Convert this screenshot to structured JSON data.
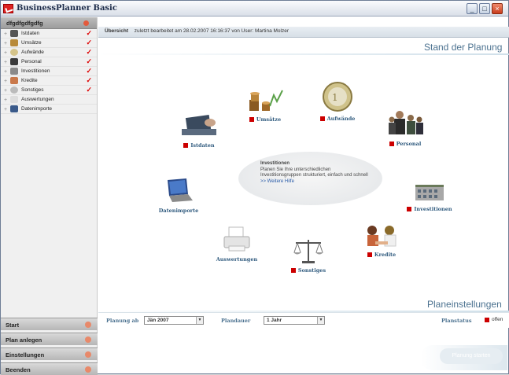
{
  "window": {
    "title": "BusinessPlanner Basic"
  },
  "sidebar": {
    "header": "dfgdfgdfgdfg",
    "items": [
      {
        "label": "Istdaten",
        "icon": "desk-user-icon",
        "checked": true
      },
      {
        "label": "Umsätze",
        "icon": "coins-icon",
        "checked": true
      },
      {
        "label": "Aufwände",
        "icon": "coin-icon",
        "checked": true
      },
      {
        "label": "Personal",
        "icon": "people-icon",
        "checked": true
      },
      {
        "label": "Investitionen",
        "icon": "building-icon",
        "checked": true
      },
      {
        "label": "Kredite",
        "icon": "handshake-icon",
        "checked": true
      },
      {
        "label": "Sonstiges",
        "icon": "scales-icon",
        "checked": true
      },
      {
        "label": "Auswertungen",
        "icon": "printer-icon",
        "checked": false
      },
      {
        "label": "Datenimporte",
        "icon": "laptop-icon",
        "checked": false
      }
    ],
    "bottom_buttons": [
      "Start",
      "Plan anlegen",
      "Einstellungen",
      "Beenden"
    ]
  },
  "breadcrumb": {
    "section": "Übersicht",
    "status": "zuletzt bearbeitet am 28.02.2007 16:16:37 von User: Martina Molzer"
  },
  "planning": {
    "title": "Stand der Planung",
    "nodes": {
      "istdaten": "Istdaten",
      "umsaetze": "Umsätze",
      "aufwaende": "Aufwände",
      "personal": "Personal",
      "investitionen": "Investitionen",
      "kredite": "Kredite",
      "sonstiges": "Sonstiges",
      "auswertungen": "Auswertungen",
      "datenimporte": "Datenimporte"
    },
    "info": {
      "title": "Investitionen",
      "text": "Planen Sie Ihre unterschiedlichen Investitionsgruppen strukturiert, einfach und schnell",
      "link": ">> Weitere Hilfe"
    }
  },
  "settings": {
    "title": "Planeinstellungen",
    "planung_ab_label": "Planung ab",
    "planung_ab_value": "Jän 2007",
    "plandauer_label": "Plandauer",
    "plandauer_value": "1 Jahr",
    "planstatus_label": "Planstatus",
    "planstatus_value": "offen"
  },
  "start_button": "Planung starten"
}
